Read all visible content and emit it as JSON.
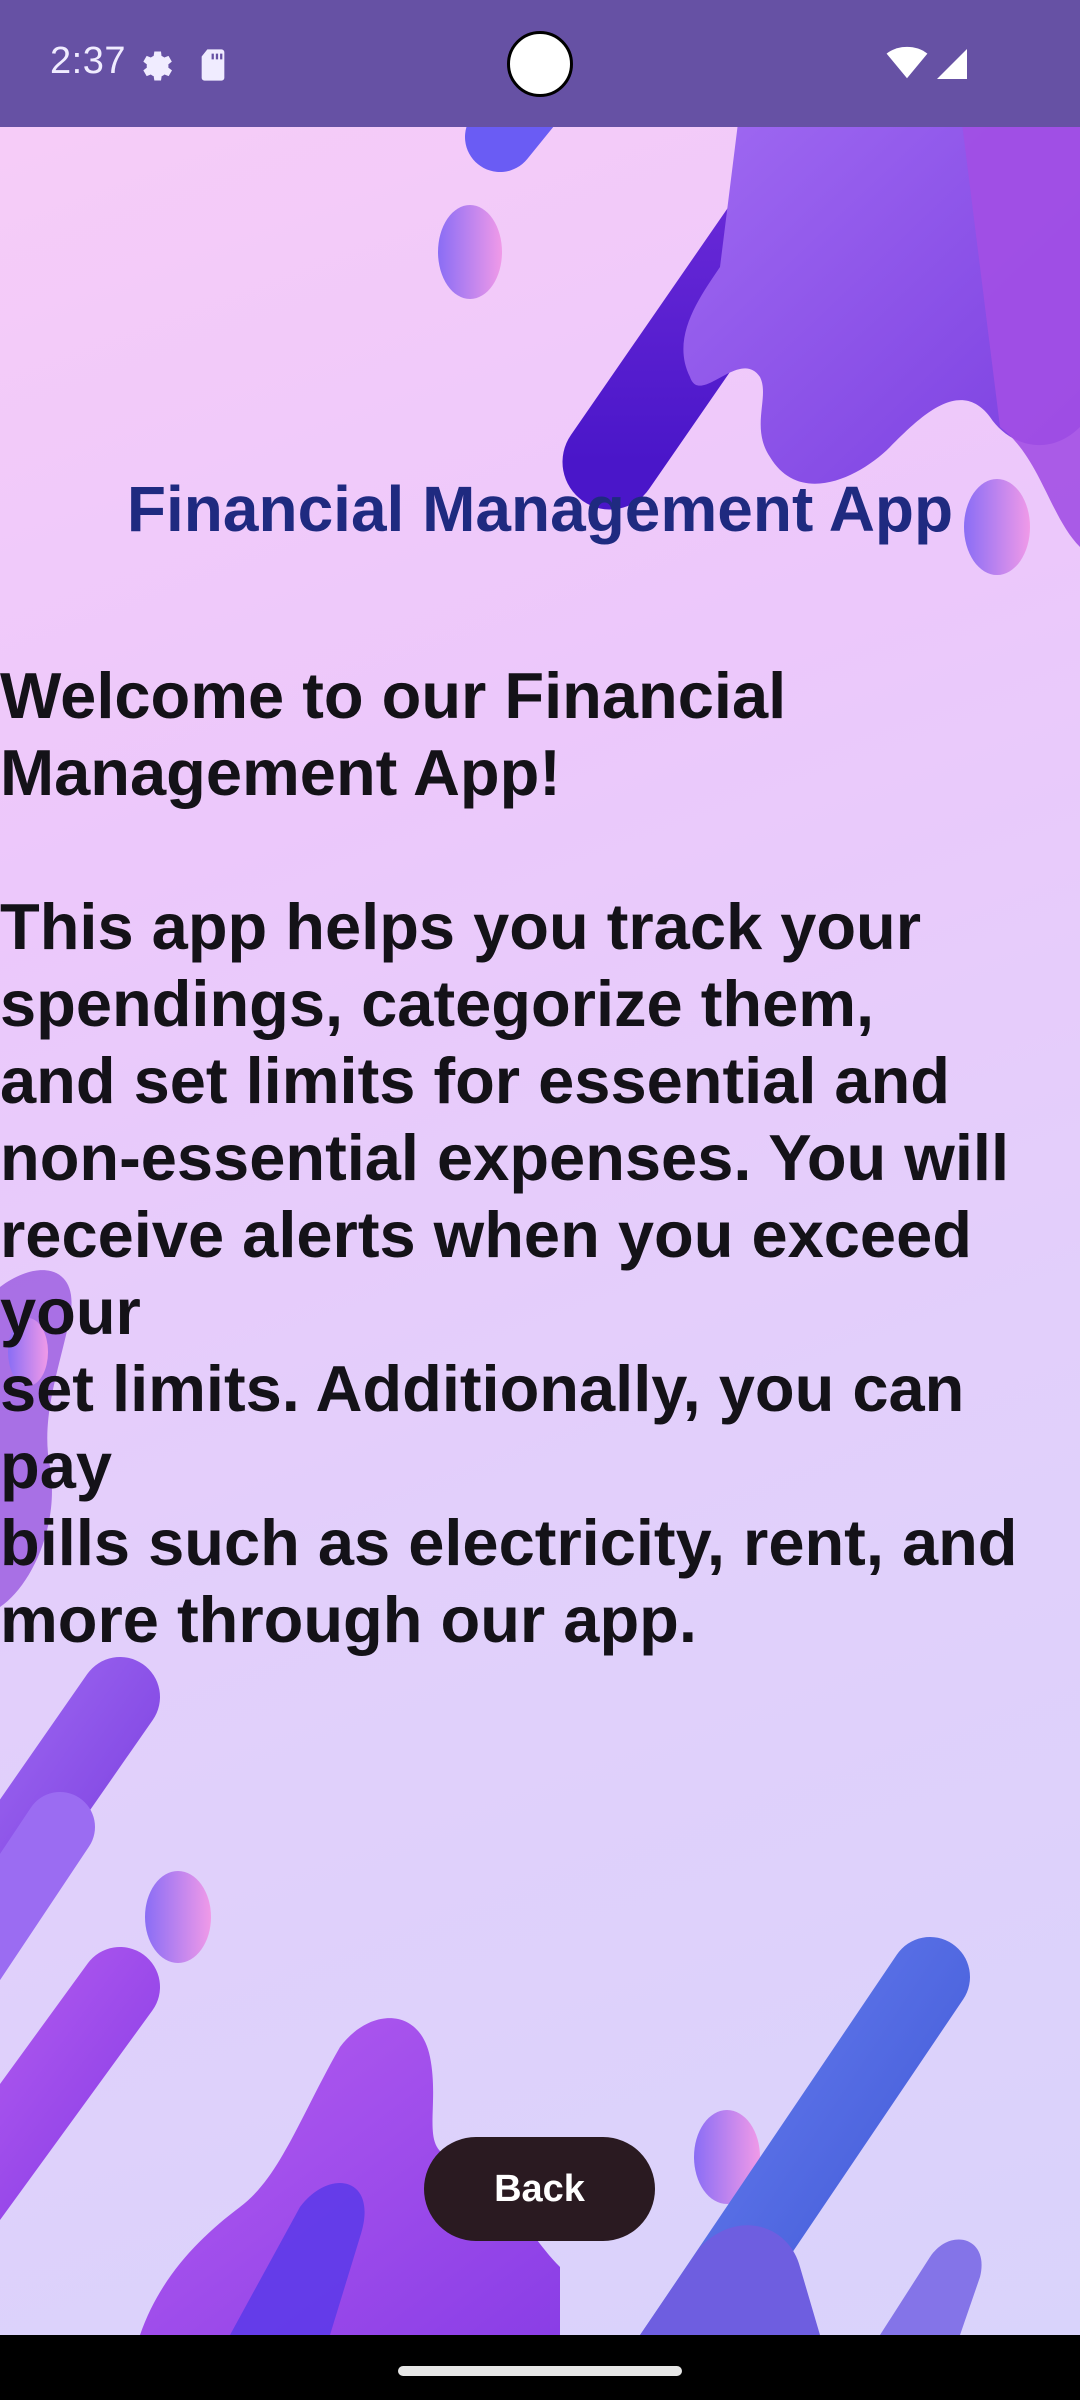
{
  "status_bar": {
    "time": "2:37",
    "icons": [
      "settings-gear-icon",
      "sd-card-icon",
      "camera-cutout",
      "wifi-icon",
      "cellular-signal-icon"
    ],
    "background_color": "#6651a4"
  },
  "main": {
    "title": "Financial Management App",
    "description": "Welcome to our Financial\nManagement App!\n\nThis app helps you track your\nspendings, categorize them,\nand set limits for essential and\nnon-essential expenses. You will\nreceive alerts when you exceed your\nset limits. Additionally, you can pay\nbills such as electricity, rent, and\nmore through our app.",
    "title_color": "#1f2a80",
    "text_color": "#141218"
  },
  "back_button": {
    "label": "Back",
    "background_color": "#2a1a21"
  },
  "nav_bar": {
    "icons": [
      "home-gesture-handle"
    ]
  }
}
